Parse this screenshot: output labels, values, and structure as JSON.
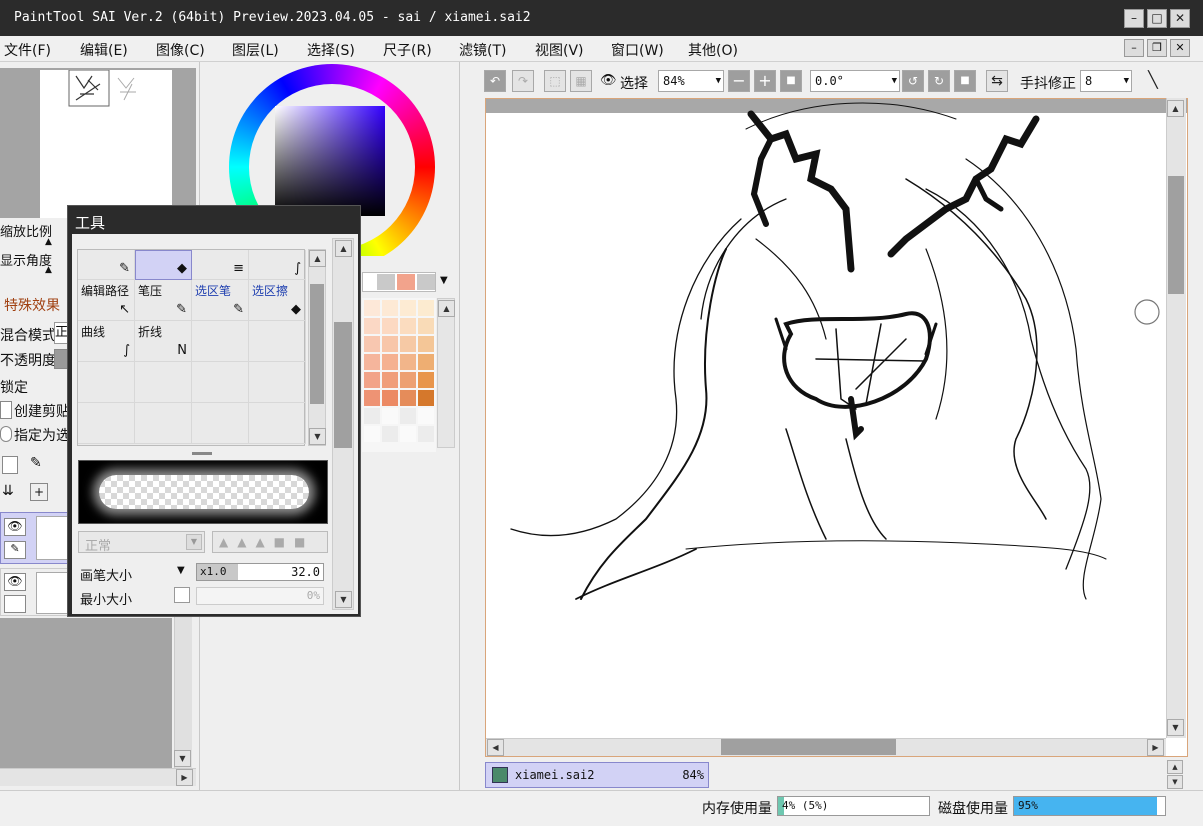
{
  "window": {
    "title": "PaintTool SAI Ver.2 (64bit) Preview.2023.04.05 - sai / xiamei.sai2",
    "minimize": "–",
    "maximize": "□",
    "close": "✕"
  },
  "menu": {
    "items": [
      "文件(F)",
      "编辑(E)",
      "图像(C)",
      "图层(L)",
      "选择(S)",
      "尺子(R)",
      "滤镜(T)",
      "视图(V)",
      "窗口(W)",
      "其他(O)"
    ],
    "mdi_minimize": "–",
    "mdi_restore": "❐",
    "mdi_close": "✕"
  },
  "left_panel": {
    "zoom_label": "缩放比例",
    "angle_label": "显示角度",
    "effects_label": "特殊效果",
    "blend_mode_label": "混合模式",
    "blend_mode_value": "正",
    "opacity_label": "不透明度",
    "lock_label": "锁定",
    "clip_label": "创建剪贴",
    "assign_label": "指定为选"
  },
  "tool_window": {
    "title": "工具",
    "tools": [
      {
        "name": "",
        "icon": "pen-icon",
        "glyph": "✎"
      },
      {
        "name": "",
        "icon": "eraser-icon",
        "glyph": "◆"
      },
      {
        "name": "",
        "icon": "lines-icon",
        "glyph": "≡"
      },
      {
        "name": "",
        "icon": "curve-tool-icon",
        "glyph": "∫"
      },
      {
        "name": "编辑路径",
        "icon": "edit-path-icon",
        "glyph": "↖"
      },
      {
        "name": "笔压",
        "icon": "pressure-icon",
        "glyph": "✎"
      },
      {
        "name": "选区笔",
        "icon": "selection-pen-icon",
        "glyph": "✎"
      },
      {
        "name": "选区擦",
        "icon": "selection-eraser-icon",
        "glyph": "◆"
      },
      {
        "name": "曲线",
        "icon": "curve-icon",
        "glyph": "∫"
      },
      {
        "name": "折线",
        "icon": "polyline-icon",
        "glyph": "N"
      }
    ],
    "brush_mode": "正常",
    "brush_size_label": "画笔大小",
    "brush_size_multiplier": "x1.0",
    "brush_size_value": "32.0",
    "min_size_label": "最小大小",
    "min_size_value": "0%"
  },
  "toolbar": {
    "select_label": "选择",
    "zoom_value": "84%",
    "angle_value": "0.0°",
    "stabilizer_label": "手抖修正",
    "stabilizer_value": "8"
  },
  "document": {
    "tab_name": "xiamei.sai2",
    "tab_zoom": "84%"
  },
  "status": {
    "memory_label": "内存使用量",
    "memory_value": "4% (5%)",
    "memory_fraction": 0.04,
    "disk_label": "磁盘使用量",
    "disk_value": "95%",
    "disk_fraction": 0.95
  },
  "colors": {
    "title_bar": "#2b2b2b",
    "selection_highlight": "#d2d2f5",
    "disk_bar": "#46b4f0",
    "memory_bar": "#6ec7b0",
    "canvas_border": "#d9a57a"
  }
}
